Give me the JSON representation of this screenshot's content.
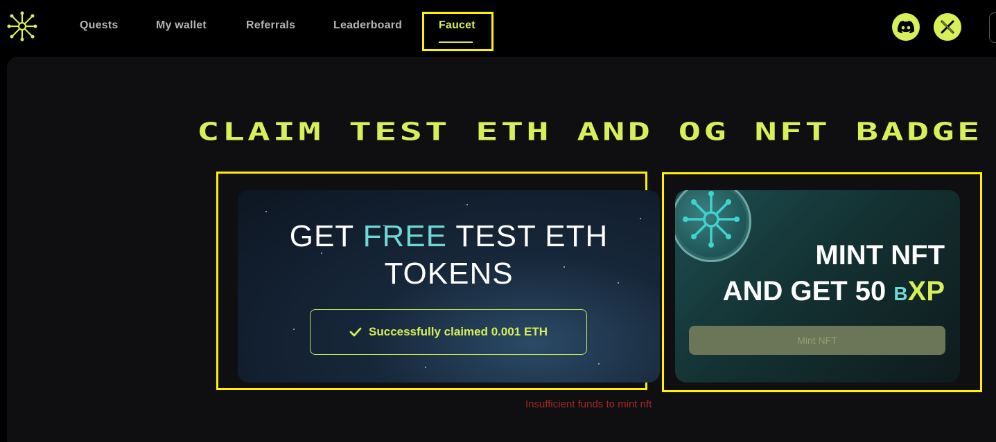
{
  "nav": {
    "items": [
      {
        "label": "Quests"
      },
      {
        "label": "My wallet"
      },
      {
        "label": "Referrals"
      },
      {
        "label": "Leaderboard"
      },
      {
        "label": "Faucet",
        "active": true
      }
    ]
  },
  "social": {
    "discord_icon": "discord-icon",
    "x_icon": "x-icon"
  },
  "headline": "CLAIM TEST ETH AND OG NFT BADGE",
  "eth_card": {
    "title_part1": "GET ",
    "title_highlight": "FREE",
    "title_part2": " TEST ETH",
    "title_line2": "TOKENS",
    "status_icon": "checkmark-icon",
    "status_text": "Successfully claimed 0.001 ETH"
  },
  "nft_card": {
    "title_line1": "MINT NFT",
    "title_line2_prefix": "AND GET 50 ",
    "title_b": "B",
    "title_xp": "XP",
    "button_label": "Mint NFT"
  },
  "error_message": "Insufficient funds to mint nft",
  "colors": {
    "accent": "#d7ef58",
    "teal": "#6fd8d6",
    "error": "#a2282a",
    "highlight_box": "#fff200"
  }
}
